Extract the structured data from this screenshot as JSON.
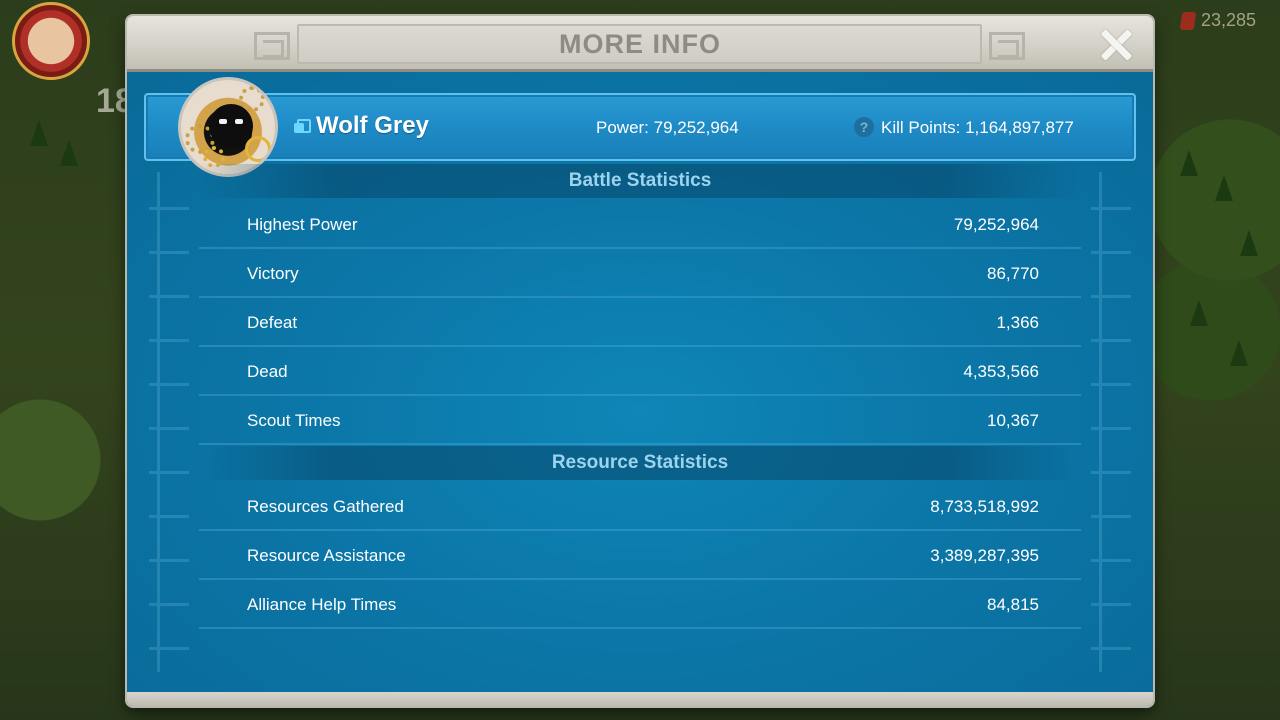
{
  "hud": {
    "level": "18",
    "gems": "23,285"
  },
  "dialog": {
    "title": "MORE INFO"
  },
  "player": {
    "name": "Wolf Grey",
    "power": "Power: 79,252,964",
    "kill_points": "Kill Points: 1,164,897,877"
  },
  "battle_statistics": {
    "title": "Battle Statistics",
    "rows": [
      {
        "label": "Highest Power",
        "value": "79,252,964"
      },
      {
        "label": "Victory",
        "value": "86,770"
      },
      {
        "label": "Defeat",
        "value": "1,366"
      },
      {
        "label": "Dead",
        "value": "4,353,566"
      },
      {
        "label": "Scout Times",
        "value": "10,367"
      }
    ]
  },
  "resource_statistics": {
    "title": "Resource Statistics",
    "rows": [
      {
        "label": "Resources Gathered",
        "value": "8,733,518,992"
      },
      {
        "label": "Resource Assistance",
        "value": "3,389,287,395"
      },
      {
        "label": "Alliance Help Times",
        "value": "84,815"
      }
    ]
  },
  "icons": {
    "close": "close-icon",
    "copy": "copy-icon",
    "help": "help-icon",
    "gem": "gem-icon"
  }
}
